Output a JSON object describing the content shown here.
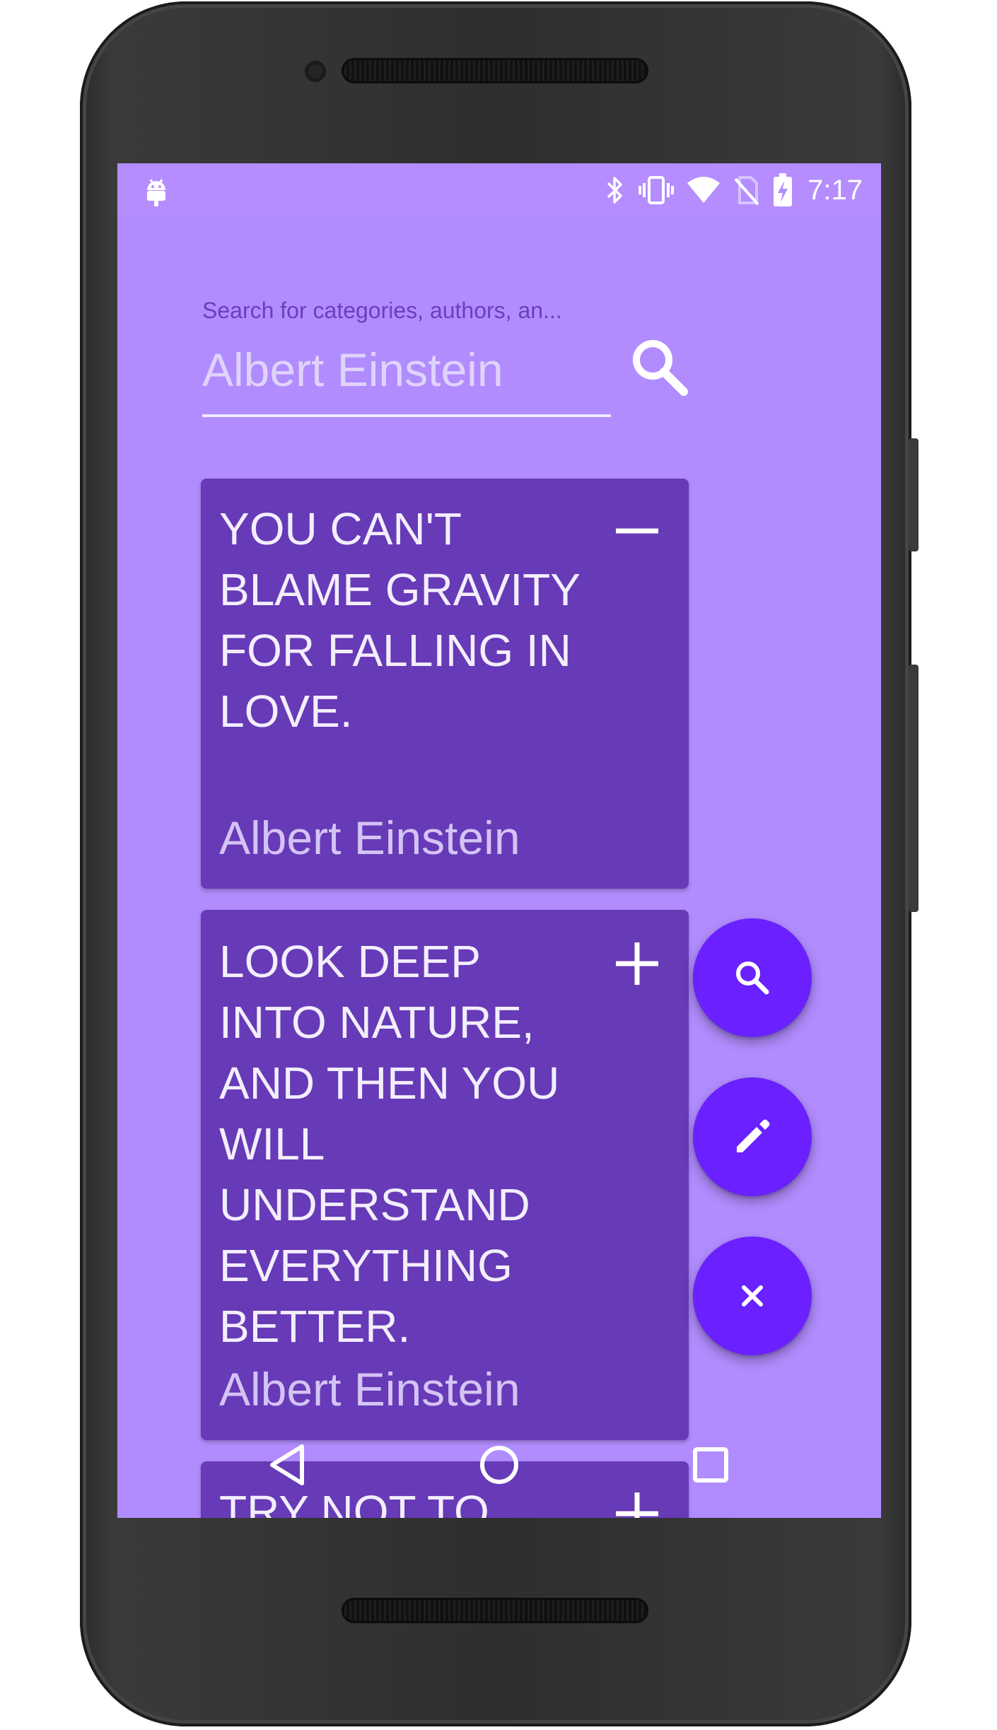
{
  "status_bar": {
    "time": "7:17",
    "icons": [
      "android-debug-icon",
      "bluetooth-icon",
      "vibrate-icon",
      "wifi-icon",
      "no-sim-icon",
      "battery-charging-icon"
    ]
  },
  "search": {
    "hint": "Search for categories, authors, an...",
    "value": "Albert Einstein",
    "button_icon": "search-icon"
  },
  "quotes": [
    {
      "text": "YOU CAN'T BLAME GRAVITY FOR FALLING IN LOVE.",
      "author": "Albert Einstein",
      "toggle": "minus-icon"
    },
    {
      "text": "LOOK DEEP INTO NATURE, AND THEN YOU WILL UNDERSTAND EVERYTHING BETTER.",
      "author": "Albert Einstein",
      "toggle": "plus-icon"
    },
    {
      "text": "TRY NOT TO",
      "toggle": "plus-icon"
    }
  ],
  "fabs": [
    "search-icon",
    "edit-icon",
    "close-icon"
  ],
  "nav": [
    "back-icon",
    "home-icon",
    "recents-icon"
  ],
  "colors": {
    "background": "#b18cfe",
    "card": "#673ab7",
    "fab": "#6a20ff",
    "hint_text": "#6a3fbe"
  }
}
